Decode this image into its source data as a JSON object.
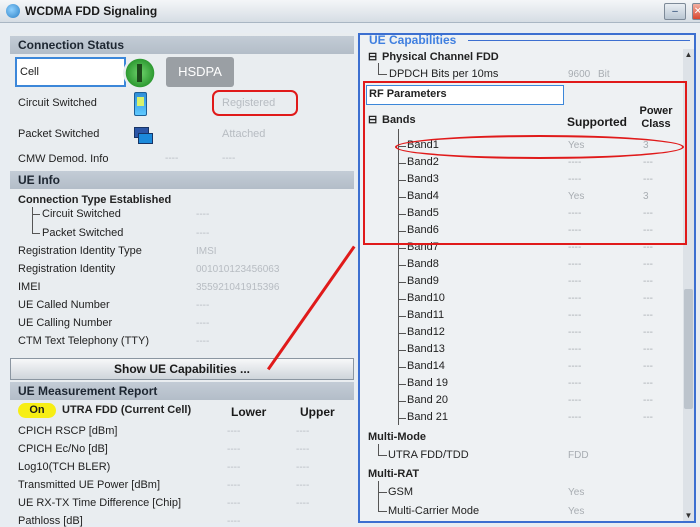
{
  "window": {
    "title": "WCDMA FDD Signaling",
    "controls": [
      "minimize-icon",
      "close-icon"
    ]
  },
  "connection_status": {
    "heading": "Connection Status",
    "cell_label": "Cell",
    "hsdpa_label": "HSDPA",
    "circuit_switched_label": "Circuit Switched",
    "circuit_switched_value": "Registered",
    "packet_switched_label": "Packet Switched",
    "packet_switched_value": "Attached",
    "cmw_demod_label": "CMW Demod. Info",
    "cmw_demod_value1": "----",
    "cmw_demod_value2": "----"
  },
  "ue_info": {
    "heading": "UE Info",
    "connection_type_label": "Connection Type Established",
    "rows": [
      {
        "label": "Circuit Switched",
        "value": "----"
      },
      {
        "label": "Packet Switched",
        "value": "----"
      },
      {
        "label": "Registration Identity Type",
        "value": "IMSI"
      },
      {
        "label": "Registration Identity",
        "value": "001010123456063"
      },
      {
        "label": "IMEI",
        "value": "355921041915396"
      },
      {
        "label": "UE Called Number",
        "value": "----"
      },
      {
        "label": "UE Calling Number",
        "value": "----"
      },
      {
        "label": "CTM Text Telephony (TTY)",
        "value": "----"
      }
    ]
  },
  "show_caps_button": "Show UE Capabilities ...",
  "measurement": {
    "heading": "UE Measurement Report",
    "on_badge": "On",
    "cell_label": "UTRA FDD (Current Cell)",
    "col_lower": "Lower",
    "col_upper": "Upper",
    "rows": [
      {
        "label": "CPICH RSCP [dBm]",
        "lower": "----",
        "upper": "----"
      },
      {
        "label": "CPICH Ec/No [dB]",
        "lower": "----",
        "upper": "----"
      },
      {
        "label": "Log10(TCH BLER)",
        "lower": "----",
        "upper": "----"
      },
      {
        "label": "Transmitted UE Power [dBm]",
        "lower": "----",
        "upper": "----"
      },
      {
        "label": "UE RX-TX Time Difference [Chip]",
        "lower": "----",
        "upper": "----"
      },
      {
        "label": "Pathloss [dB]",
        "lower": "----",
        "upper": ""
      }
    ]
  },
  "ue_caps": {
    "heading": "UE Capabilities",
    "physical_channel": "Physical Channel FDD",
    "dpdch_label": "DPDCH Bits per 10ms",
    "dpdch_value": "9600",
    "dpdch_unit": "Bit",
    "rf_params": "RF Parameters",
    "bands_label": "Bands",
    "col_supported": "Supported",
    "col_power_class": "Power Class",
    "bands": [
      {
        "name": "Band1",
        "supported": "Yes",
        "power": "3"
      },
      {
        "name": "Band2",
        "supported": "----",
        "power": "---"
      },
      {
        "name": "Band3",
        "supported": "----",
        "power": "---"
      },
      {
        "name": "Band4",
        "supported": "Yes",
        "power": "3"
      },
      {
        "name": "Band5",
        "supported": "----",
        "power": "---"
      },
      {
        "name": "Band6",
        "supported": "----",
        "power": "---"
      },
      {
        "name": "Band7",
        "supported": "----",
        "power": "---"
      },
      {
        "name": "Band8",
        "supported": "----",
        "power": "---"
      },
      {
        "name": "Band9",
        "supported": "----",
        "power": "---"
      },
      {
        "name": "Band10",
        "supported": "----",
        "power": "---"
      },
      {
        "name": "Band11",
        "supported": "----",
        "power": "---"
      },
      {
        "name": "Band12",
        "supported": "----",
        "power": "---"
      },
      {
        "name": "Band13",
        "supported": "----",
        "power": "---"
      },
      {
        "name": "Band14",
        "supported": "----",
        "power": "---"
      },
      {
        "name": "Band 19",
        "supported": "----",
        "power": "---"
      },
      {
        "name": "Band 20",
        "supported": "----",
        "power": "---"
      },
      {
        "name": "Band 21",
        "supported": "----",
        "power": "---"
      }
    ],
    "multi_mode": "Multi-Mode",
    "utra_fdd_tdd_label": "UTRA FDD/TDD",
    "utra_fdd_tdd_value": "FDD",
    "multi_rat": "Multi-RAT",
    "gsm_label": "GSM",
    "gsm_value": "Yes",
    "multi_carrier_label": "Multi-Carrier Mode",
    "multi_carrier_value": "Yes"
  },
  "colors": {
    "highlight_red": "#e01a1a",
    "accent_blue": "#3c6fd0",
    "on_yellow": "#f7ee14"
  }
}
